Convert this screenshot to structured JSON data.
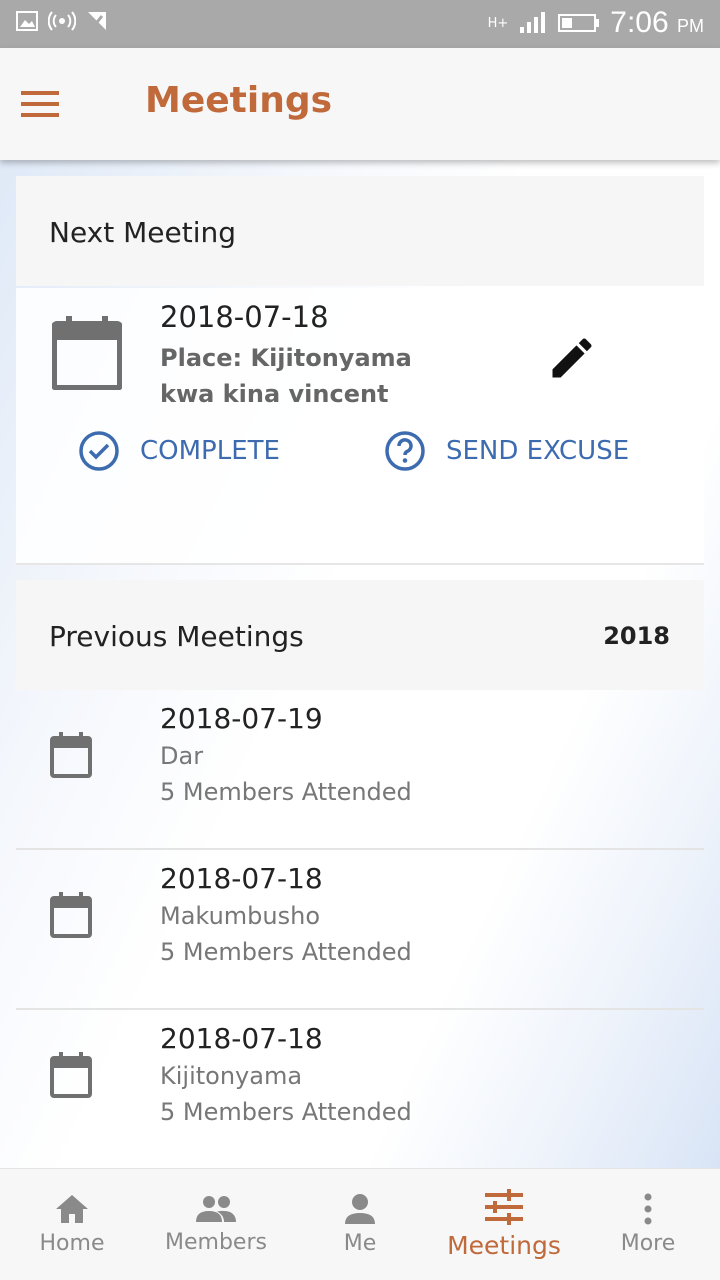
{
  "status_bar": {
    "time": "7:06",
    "ampm": "PM",
    "network": "H+"
  },
  "app_bar": {
    "title": "Meetings"
  },
  "next_meeting": {
    "header": "Next Meeting",
    "date": "2018-07-18",
    "place_line1": "Place: Kijitonyama",
    "place_line2": "kwa kina vincent",
    "complete_label": "COMPLETE",
    "excuse_label": "SEND EXCUSE"
  },
  "previous_meetings": {
    "header": "Previous Meetings",
    "year": "2018",
    "items": [
      {
        "date": "2018-07-19",
        "place": "Dar",
        "attendance": "5 Members Attended"
      },
      {
        "date": "2018-07-18",
        "place": "Makumbusho",
        "attendance": "5 Members Attended"
      },
      {
        "date": "2018-07-18",
        "place": "Kijitonyama",
        "attendance": "5 Members Attended"
      }
    ]
  },
  "bottom_nav": {
    "items": [
      {
        "label": "Home",
        "icon": "home-icon"
      },
      {
        "label": "Members",
        "icon": "people-icon"
      },
      {
        "label": "Me",
        "icon": "person-icon"
      },
      {
        "label": "Meetings",
        "icon": "tune-icon"
      },
      {
        "label": "More",
        "icon": "more-vert-icon"
      }
    ]
  },
  "colors": {
    "accent": "#c0693a",
    "link": "#3d6bb0",
    "status_bar": "#a9a9a9"
  }
}
